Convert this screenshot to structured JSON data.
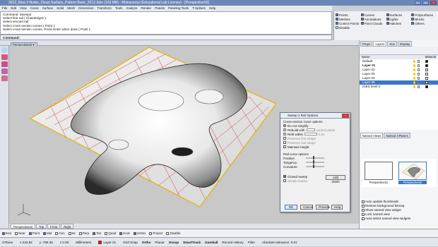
{
  "titlebar": {
    "title": "2012_New 3 Nurbs_Clean Surface_Pattern Base_2012.3dm (103 MB) - Rhinoceros (Educational Lab License) - [Perspective02]"
  },
  "menu": [
    "File",
    "Edit",
    "View",
    "Curve",
    "Surface",
    "Solid",
    "Mesh",
    "Dimension",
    "Transform",
    "Tools",
    "Analyze",
    "Render",
    "Panels",
    "Paneling Tools",
    "T-Splines",
    "Help"
  ],
  "command_history": [
    "Command: Sweep2",
    "Select first rail ( ChainEdges ):",
    "Select second rail:",
    "Select cross section curves ( Point ):",
    "Select cross section curves. Press Enter when done ( Point ):"
  ],
  "command_prompt": "Command:",
  "osnap_top": [
    "Points",
    "Curves",
    "Surfaces",
    "Polysurfaces",
    "Meshes",
    "Annotations",
    "Lights",
    "Blocks",
    "Control Points",
    "Point Clouds",
    "Hatches",
    "Others",
    "Disable"
  ],
  "viewport": {
    "tab_label": "Perspective02",
    "tabs": [
      "Perspective02",
      "Top",
      "Front",
      "Right"
    ]
  },
  "osnap_bottom": [
    {
      "label": "End",
      "on": true
    },
    {
      "label": "Near",
      "on": false
    },
    {
      "label": "Point",
      "on": true
    },
    {
      "label": "Mid",
      "on": true
    },
    {
      "label": "Cen",
      "on": false
    },
    {
      "label": "Int",
      "on": false
    },
    {
      "label": "Perp",
      "on": false
    },
    {
      "label": "Tan",
      "on": true
    },
    {
      "label": "Quad",
      "on": false
    },
    {
      "label": "Knot",
      "on": true
    },
    {
      "label": "Vertex",
      "on": true
    },
    {
      "label": "Project",
      "on": false
    },
    {
      "label": "Disable",
      "on": false
    }
  ],
  "status": {
    "cplane": "CPlane",
    "x": "x 233.82",
    "y": "y -789.35",
    "z": "z 0.00",
    "units": "Millimeters",
    "layer": "Layer 01",
    "toggles": [
      "Grid Snap",
      "Ortho",
      "Planar",
      "Osnap",
      "SmartTrack",
      "Gumball",
      "Record History",
      "Filter"
    ],
    "tolerance": "Absolute tolerance: 0.01"
  },
  "panel": {
    "tabs": [
      "Prope",
      "Layers",
      "Sun",
      "Display"
    ],
    "columns": [
      "Name",
      "Material"
    ],
    "layers": [
      {
        "name": "Default",
        "color": "#000000"
      },
      {
        "name": "Layer 01",
        "color": "#000000",
        "current": true
      },
      {
        "name": "Layer 02",
        "color": "#ffffff"
      },
      {
        "name": "Layer 03",
        "color": "#ffffff"
      },
      {
        "name": "Layer 04",
        "color": "#ffffff"
      },
      {
        "name": "Layer 05",
        "color": "#ffffff",
        "selected": true
      },
      {
        "name": "IGES level 0",
        "color": "#000000"
      }
    ],
    "bottom_tabs": [
      "Named Views",
      "Named CPlanes"
    ],
    "thumbs": [
      {
        "label": "Perspective01"
      },
      {
        "label": "Perspective02",
        "selected": true
      }
    ],
    "options": [
      "Auto update thumbnails",
      "Restore background bitmap",
      "Show named view widget",
      "Lock named view",
      "Auto-select named view widgets"
    ]
  },
  "dialog": {
    "title": "Sweep 2 Rail Options",
    "cross_section_label": "Cross-section curve options",
    "do_not_simplify": "Do not simplify",
    "rebuild_with": "Rebuild with",
    "control_points": "control points",
    "refit_within": "Refit within",
    "refit_value": "0.01",
    "preserve_first": "Preserve first shape",
    "preserve_second": "Preserve last shape",
    "maintain_height": "Maintain height",
    "rail_curve_label": "Rail curve options",
    "rail_rows": [
      "Position",
      "Tangency",
      "Curvature"
    ],
    "closed_sweep": "Closed sweep",
    "simple_sweep": "Simple sweep",
    "add_slash": "Add Slash",
    "buttons": [
      "OK",
      "Cancel",
      "Preview",
      "Help"
    ]
  }
}
